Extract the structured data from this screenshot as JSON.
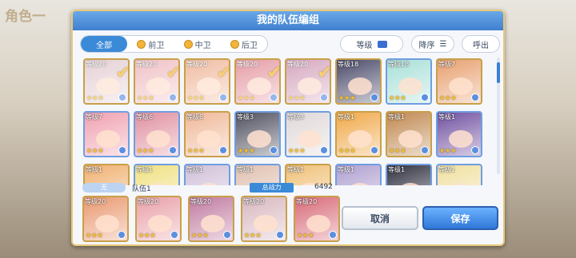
{
  "background": {
    "title": "角色一"
  },
  "dialog": {
    "title": "我的队伍编组"
  },
  "filters": {
    "tabs": [
      {
        "label": "全部",
        "active": true
      },
      {
        "label": "前卫",
        "active": false
      },
      {
        "label": "中卫",
        "active": false
      },
      {
        "label": "后卫",
        "active": false
      }
    ],
    "sort_label": "等级",
    "order_label": "降序",
    "call_label": "呼出"
  },
  "characters": [
    {
      "level": "等级20",
      "stars": "★★★",
      "selected": true,
      "color": "#d8b8c0",
      "frame": "gold"
    },
    {
      "level": "等级20",
      "stars": "★★★",
      "selected": true,
      "color": "#e9a0a8",
      "frame": "gold"
    },
    {
      "level": "等级20",
      "stars": "★★★",
      "selected": true,
      "color": "#e99870",
      "frame": "gold"
    },
    {
      "level": "等级20",
      "stars": "★★★",
      "selected": true,
      "color": "#d86a78",
      "frame": "gold"
    },
    {
      "level": "等级20",
      "stars": "★★★",
      "selected": true,
      "color": "#c07aa0",
      "frame": "gold"
    },
    {
      "level": "等级18",
      "stars": "★★★",
      "selected": false,
      "color": "#4a4a6a",
      "frame": "gold"
    },
    {
      "level": "等级18",
      "stars": "★★★",
      "selected": false,
      "color": "#a8e0d8",
      "frame": "blue"
    },
    {
      "level": "等级7",
      "stars": "★★★",
      "selected": false,
      "color": "#e8a070",
      "frame": "gold"
    },
    {
      "level": "等级7",
      "stars": "★★★",
      "selected": false,
      "color": "#f0a0b0",
      "frame": "blue"
    },
    {
      "level": "等级6",
      "stars": "★★★",
      "selected": false,
      "color": "#e090a0",
      "frame": "blue"
    },
    {
      "level": "等级6",
      "stars": "★★★",
      "selected": false,
      "color": "#f0b898",
      "frame": "gold"
    },
    {
      "level": "等级3",
      "stars": "★★★",
      "selected": false,
      "color": "#505060",
      "frame": "blue"
    },
    {
      "level": "等级3",
      "stars": "★★★",
      "selected": false,
      "color": "#e0d8d8",
      "frame": "blue"
    },
    {
      "level": "等级1",
      "stars": "★★★",
      "selected": false,
      "color": "#f0a848",
      "frame": "gold"
    },
    {
      "level": "等级1",
      "stars": "★★★",
      "selected": false,
      "color": "#c08850",
      "frame": "gold"
    },
    {
      "level": "等级1",
      "stars": "★★★",
      "selected": false,
      "color": "#7050a0",
      "frame": "blue"
    },
    {
      "level": "等级1",
      "stars": "",
      "selected": false,
      "color": "#f0b070",
      "frame": "gold"
    },
    {
      "level": "等级1",
      "stars": "",
      "selected": false,
      "color": "#f0e080",
      "frame": "blue"
    },
    {
      "level": "等级1",
      "stars": "",
      "selected": false,
      "color": "#d0c0d8",
      "frame": "blue"
    },
    {
      "level": "等级1",
      "stars": "",
      "selected": false,
      "color": "#e0c0b0",
      "frame": "blue"
    },
    {
      "level": "等级1",
      "stars": "",
      "selected": false,
      "color": "#f0c078",
      "frame": "gold"
    },
    {
      "level": "等级1",
      "stars": "",
      "selected": false,
      "color": "#b0a0d0",
      "frame": "blue"
    },
    {
      "level": "等级1",
      "stars": "",
      "selected": false,
      "color": "#303040",
      "frame": "blue"
    },
    {
      "level": "等级1",
      "stars": "",
      "selected": false,
      "color": "#f0e0a0",
      "frame": "blue"
    }
  ],
  "team": {
    "slot_tag": "无",
    "name": "队伍1",
    "power_label": "总战力",
    "power_value": "6492",
    "members": [
      {
        "level": "等级20",
        "stars": "★★★",
        "color": "#e99870"
      },
      {
        "level": "等级20",
        "stars": "★★★",
        "color": "#e9a0a8"
      },
      {
        "level": "等级20",
        "stars": "★★★",
        "color": "#c07aa0"
      },
      {
        "level": "等级20",
        "stars": "★★★",
        "color": "#d8b8c0"
      },
      {
        "level": "等级20",
        "stars": "★★★",
        "color": "#d86a78"
      }
    ]
  },
  "buttons": {
    "cancel": "取消",
    "save": "保存"
  }
}
